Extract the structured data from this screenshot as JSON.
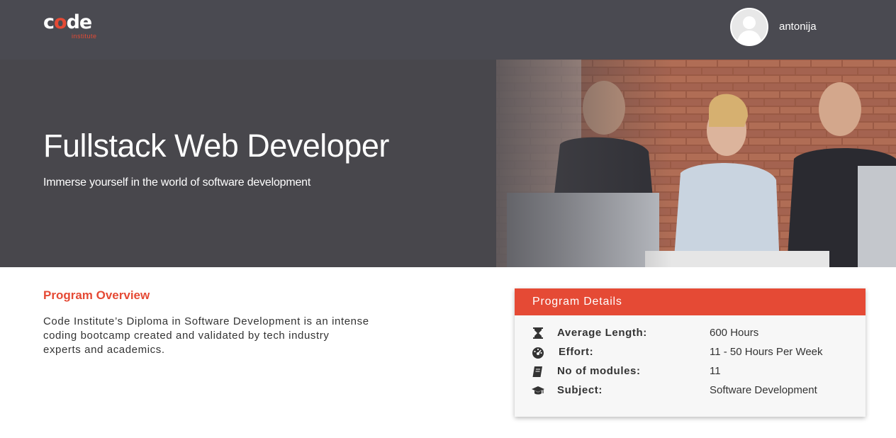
{
  "header": {
    "logo_word_prefix": "c",
    "logo_word_o": "o",
    "logo_word_suffix": "de",
    "logo_sub": "institute",
    "username": "antonija"
  },
  "hero": {
    "title": "Fullstack Web Developer",
    "subtitle": "Immerse yourself in the world of software development"
  },
  "overview": {
    "heading": "Program Overview",
    "text": "Code Institute’s Diploma in Software Development is an intense coding bootcamp created and validated by tech industry experts and academics."
  },
  "details": {
    "title": "Program Details",
    "rows": [
      {
        "icon": "hourglass-icon",
        "label": "Average Length:",
        "value": "600 Hours"
      },
      {
        "icon": "gauge-icon",
        "label": "Effort:",
        "value": "11 - 50 Hours Per Week"
      },
      {
        "icon": "book-icon",
        "label": "No of modules:",
        "value": "11"
      },
      {
        "icon": "graduation-cap-icon",
        "label": "Subject:",
        "value": "Software Development"
      }
    ]
  },
  "colors": {
    "accent": "#e54a35",
    "topbar": "#4a4a51",
    "hero_bg": "#48474c"
  }
}
